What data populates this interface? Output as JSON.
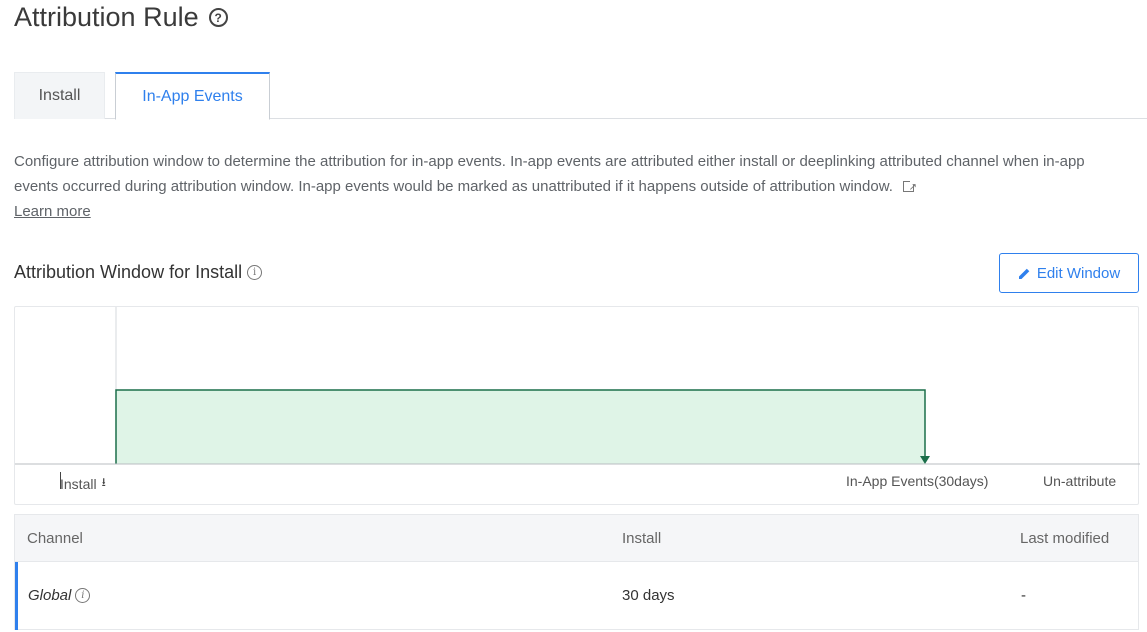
{
  "page": {
    "title": "Attribution Rule",
    "help_icon": "question-circle-icon"
  },
  "tabs": [
    {
      "label": "Install",
      "active": false
    },
    {
      "label": "In-App Events",
      "active": true
    }
  ],
  "description": {
    "text": "Configure attribution window to determine the attribution for in-app events. In-app events are attributed either install or deeplinking attributed channel when in-app events occurred during attribution window. In-app events would be marked as unattributed if it happens outside of attribution window.",
    "learn_more": "Learn more"
  },
  "section": {
    "title": "Attribution Window for Install",
    "edit_button": "Edit Window"
  },
  "timeline": {
    "start_label": "Install",
    "window_label": "In-App Events(30days)",
    "end_label": "Un-attribute",
    "window_days": 30,
    "colors": {
      "fill": "#dff4e7",
      "stroke": "#1b6e4a"
    }
  },
  "table": {
    "headers": {
      "channel": "Channel",
      "install": "Install",
      "modified": "Last modified"
    },
    "rows": [
      {
        "channel": "Global",
        "install": "30 days",
        "modified": "-"
      }
    ]
  },
  "colors": {
    "accent": "#2f80ed"
  }
}
